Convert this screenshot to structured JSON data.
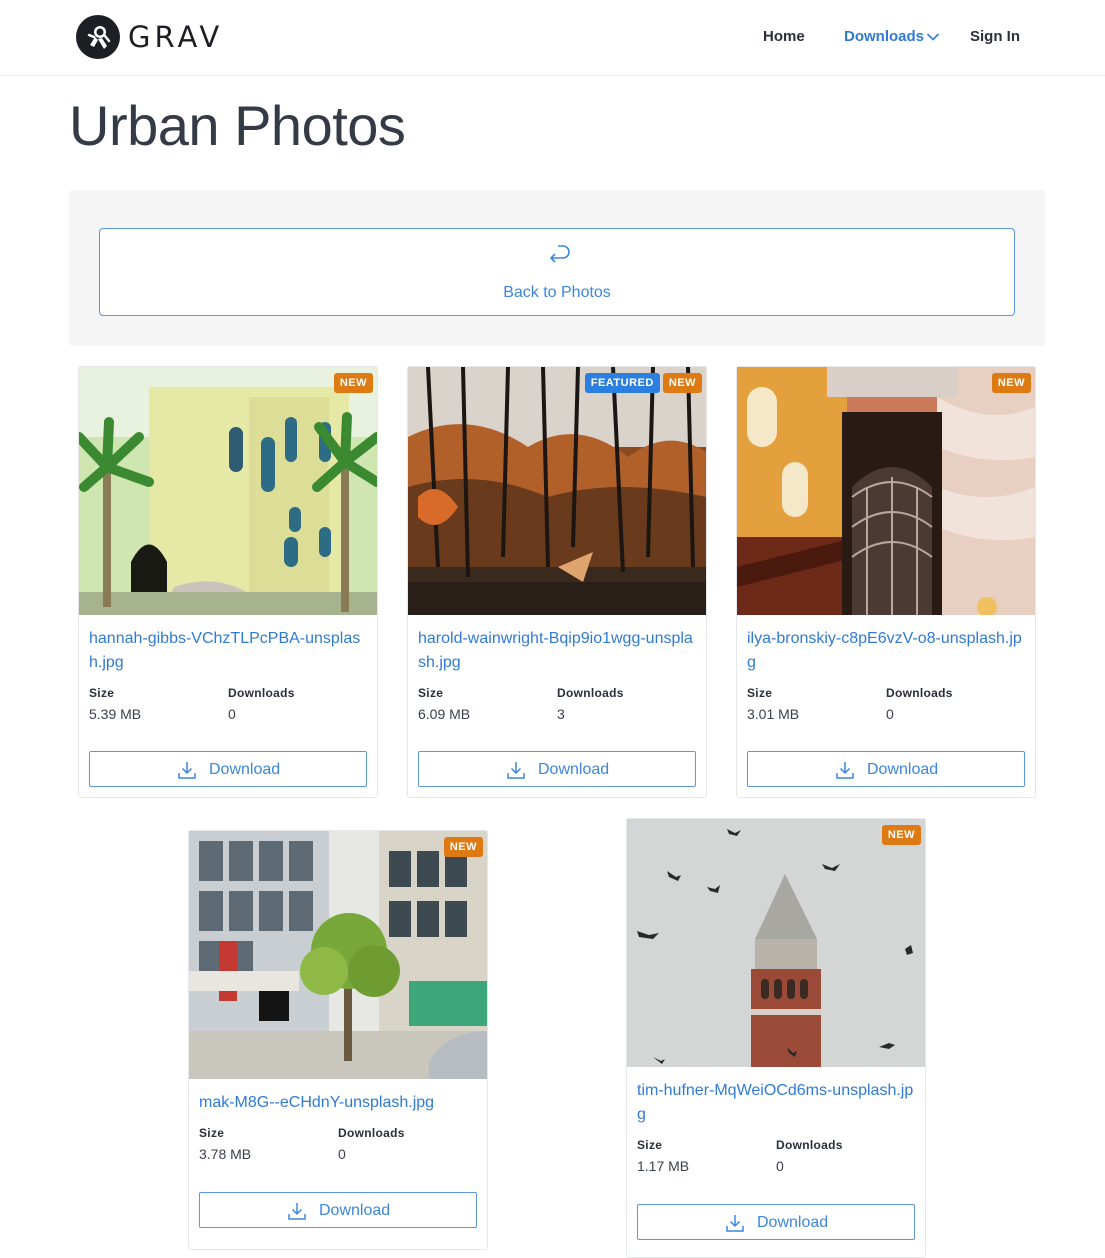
{
  "brand": {
    "name": "GRAV"
  },
  "nav": {
    "home": "Home",
    "downloads": "Downloads",
    "signin": "Sign In"
  },
  "page": {
    "title": "Urban Photos"
  },
  "back": {
    "label": "Back to Photos"
  },
  "labels": {
    "size": "Size",
    "downloads": "Downloads",
    "download_button": "Download"
  },
  "cards": [
    {
      "filename": "hannah-gibbs-VChzTLPcPBA-unsplash.jpg",
      "size": "5.39 MB",
      "downloads": "0",
      "badges": [
        "NEW"
      ]
    },
    {
      "filename": "harold-wainwright-Bqip9io1wgg-unsplash.jpg",
      "size": "6.09 MB",
      "downloads": "3",
      "badges": [
        "FEATURED",
        "NEW"
      ]
    },
    {
      "filename": "ilya-bronskiy-c8pE6vzV-o8-unsplash.jpg",
      "size": "3.01 MB",
      "downloads": "0",
      "badges": [
        "NEW"
      ]
    },
    {
      "filename": "mak-M8G--eCHdnY-unsplash.jpg",
      "size": "3.78 MB",
      "downloads": "0",
      "badges": [
        "NEW"
      ]
    },
    {
      "filename": "tim-hufner-MqWeiOCd6ms-unsplash.jpg",
      "size": "1.17 MB",
      "downloads": "0",
      "badges": [
        "NEW"
      ]
    }
  ],
  "colors": {
    "accent": "#2f7ad8",
    "badge_new": "#de7a14",
    "badge_featured": "#2b7fe0"
  }
}
